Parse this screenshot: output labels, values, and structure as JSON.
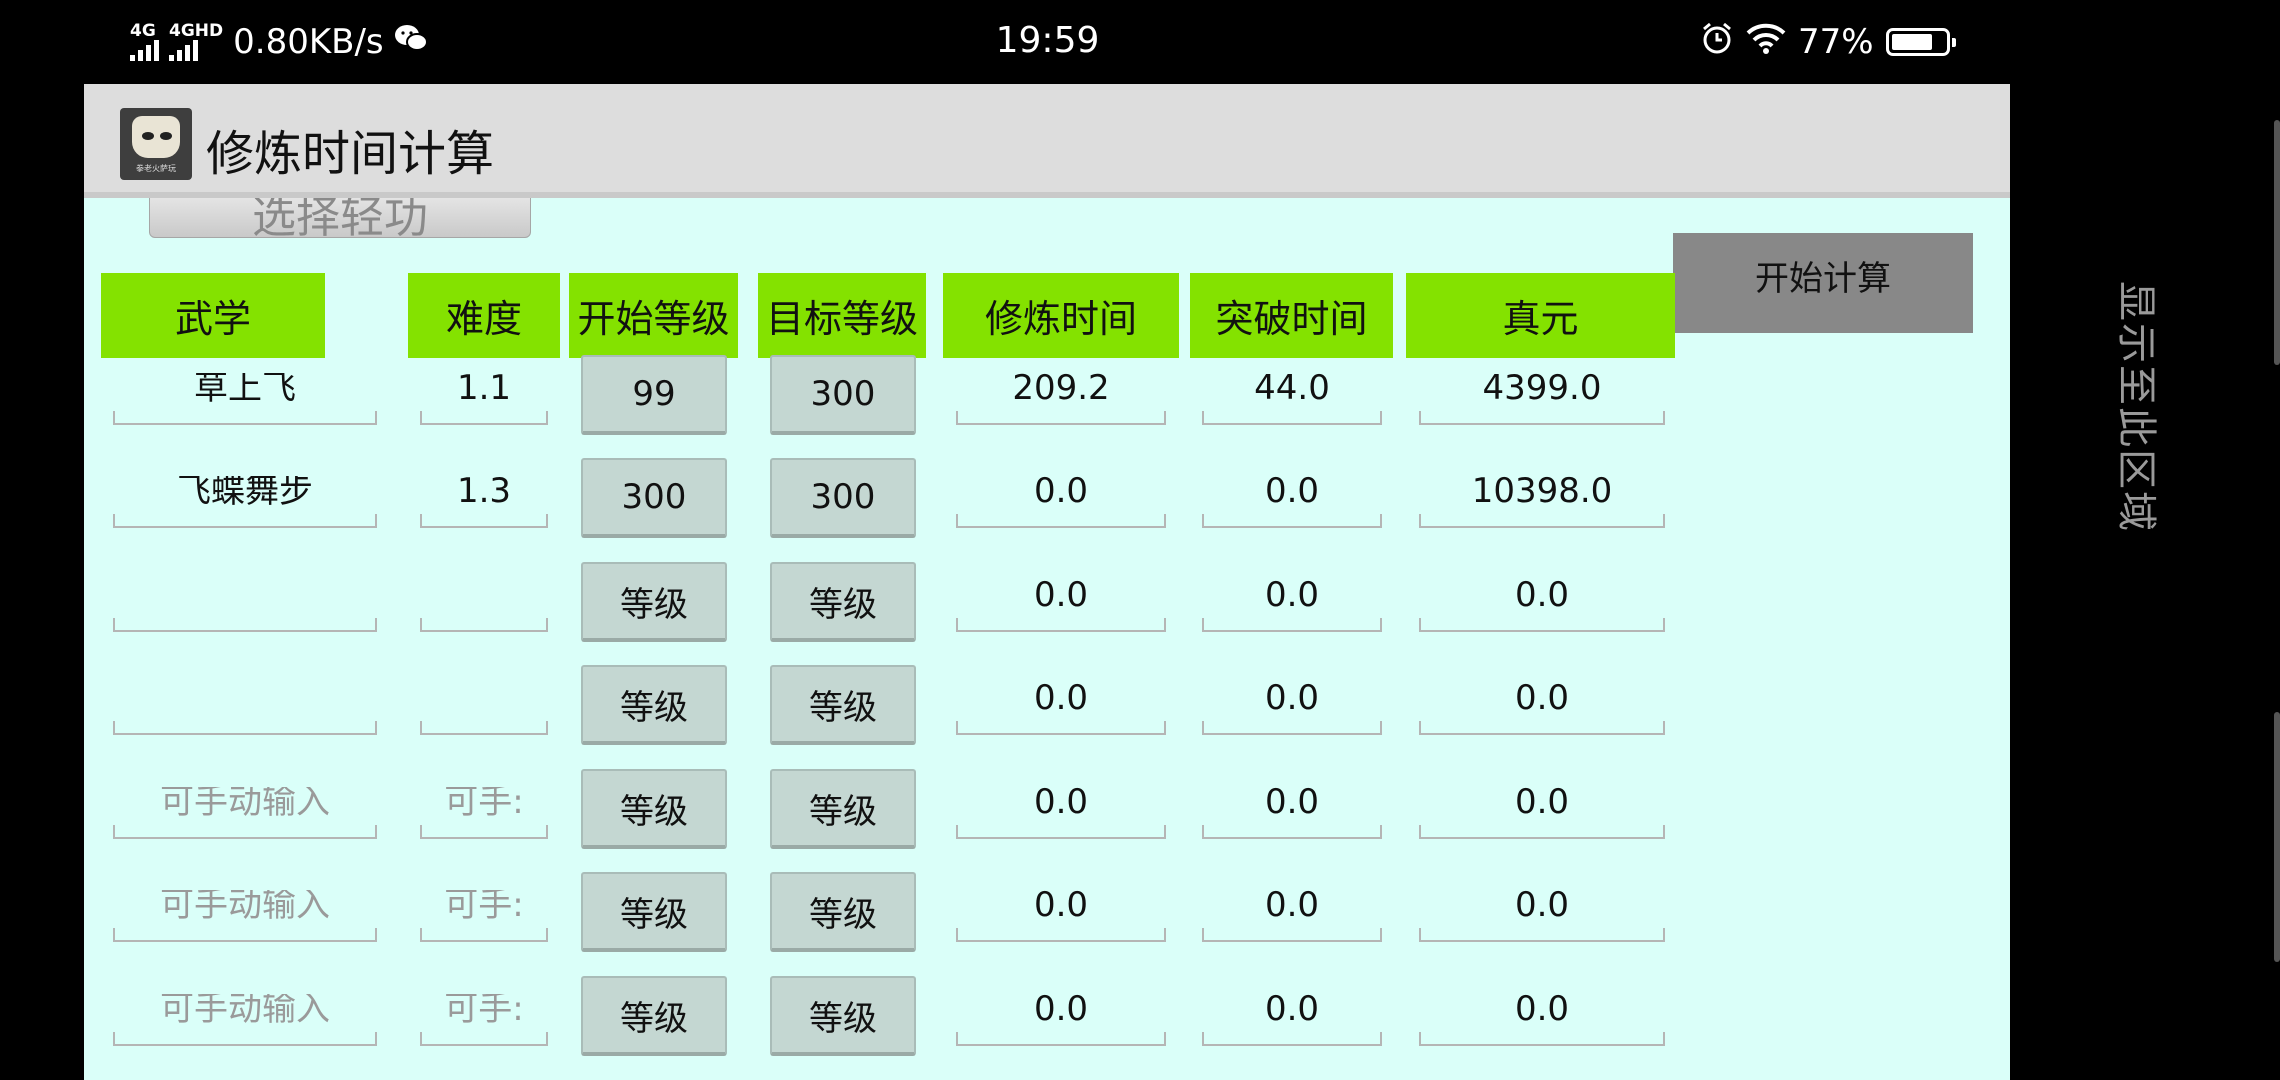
{
  "status_bar": {
    "signal1": "4G",
    "signal2": "4GHD",
    "speed": "0.80KB/s",
    "time": "19:59",
    "battery": "77%",
    "battery_level": 0.77
  },
  "app": {
    "title": "修炼时间计算",
    "icon_caption": "拳老火萨玩",
    "select_button": "选择轻功",
    "calc_button": "开始计算"
  },
  "headers": [
    "武学",
    "难度",
    "开始等级",
    "目标等级",
    "修炼时间",
    "突破时间",
    "真元"
  ],
  "rows": [
    {
      "skill": "草上飞",
      "skill_placeholder": "",
      "difficulty": "1.1",
      "difficulty_placeholder": "",
      "start": "99",
      "target": "300",
      "train_time": "209.2",
      "break_time": "44.0",
      "zhenyuan": "4399.0"
    },
    {
      "skill": "飞蝶舞步",
      "skill_placeholder": "",
      "difficulty": "1.3",
      "difficulty_placeholder": "",
      "start": "300",
      "target": "300",
      "train_time": "0.0",
      "break_time": "0.0",
      "zhenyuan": "10398.0"
    },
    {
      "skill": "",
      "skill_placeholder": "",
      "difficulty": "",
      "difficulty_placeholder": "",
      "start": "等级",
      "target": "等级",
      "train_time": "0.0",
      "break_time": "0.0",
      "zhenyuan": "0.0"
    },
    {
      "skill": "",
      "skill_placeholder": "",
      "difficulty": "",
      "difficulty_placeholder": "",
      "start": "等级",
      "target": "等级",
      "train_time": "0.0",
      "break_time": "0.0",
      "zhenyuan": "0.0"
    },
    {
      "skill": "",
      "skill_placeholder": "可手动输入",
      "difficulty": "",
      "difficulty_placeholder": "可手:",
      "start": "等级",
      "target": "等级",
      "train_time": "0.0",
      "break_time": "0.0",
      "zhenyuan": "0.0"
    },
    {
      "skill": "",
      "skill_placeholder": "可手动输入",
      "difficulty": "",
      "difficulty_placeholder": "可手:",
      "start": "等级",
      "target": "等级",
      "train_time": "0.0",
      "break_time": "0.0",
      "zhenyuan": "0.0"
    },
    {
      "skill": "",
      "skill_placeholder": "可手动输入",
      "difficulty": "",
      "difficulty_placeholder": "可手:",
      "start": "等级",
      "target": "等级",
      "train_time": "0.0",
      "break_time": "0.0",
      "zhenyuan": "0.0"
    }
  ],
  "side_hint": "显示至此区域"
}
